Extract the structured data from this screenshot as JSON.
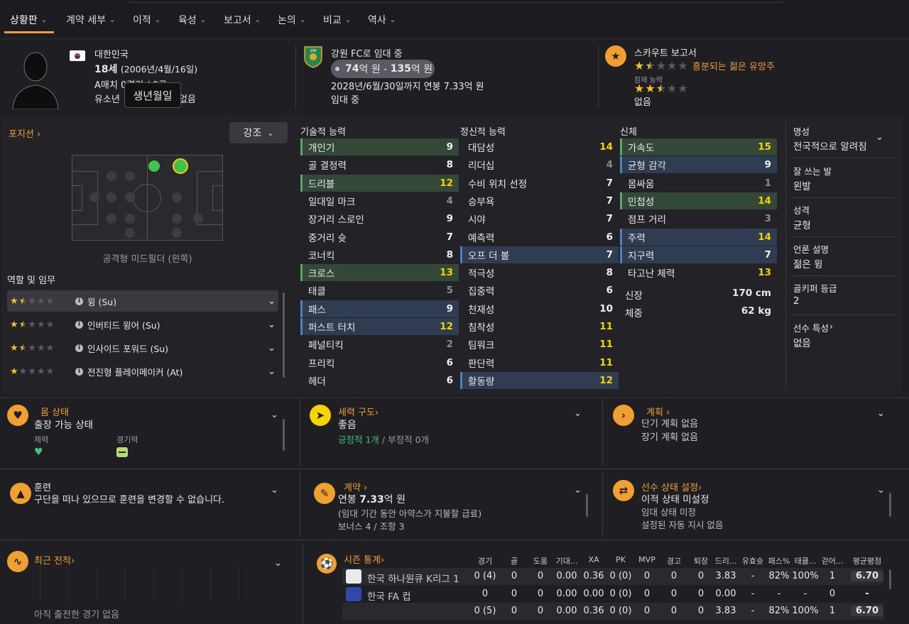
{
  "tabs": [
    {
      "label": "상황판"
    },
    {
      "label": "계약 세부"
    },
    {
      "label": "이적"
    },
    {
      "label": "육성"
    },
    {
      "label": "보고서"
    },
    {
      "label": "논의"
    },
    {
      "label": "비교"
    },
    {
      "label": "역사"
    }
  ],
  "header": {
    "nationality": "대한민국",
    "age": "18세",
    "dob": "(2006년/4월/16일)",
    "intl_line": "A매치 0경기 / 0골",
    "youth_line": "유소년",
    "youth_suffix": "없음",
    "tooltip": "생년월일",
    "loan_club": "강원 FC로 임대 중",
    "value_low": "74",
    "value_unit1": "억 원 - ",
    "value_high": "135",
    "value_unit2": "억 원",
    "contract_line": "2028년/6월/30일까지 연봉 7.33억 원",
    "loan_status": "임대 중",
    "scout_title": "스카우트 보고서",
    "scout_verdict": "흥분되는 젊은 유망주",
    "potential_label": "잠재 능력",
    "scout_none": "없음",
    "current_stars": 1.5,
    "potential_stars": 2.5
  },
  "position": {
    "label": "포지션",
    "highlight_button": "강조",
    "position_name": "공격형 미드필더 (왼쪽)"
  },
  "roles": {
    "label": "역할 및 임무",
    "items": [
      {
        "name": "윙 (Su)",
        "stars": 1.5
      },
      {
        "name": "인버티드 윙어 (Su)",
        "stars": 1.5
      },
      {
        "name": "인사이드 포워드 (Su)",
        "stars": 1.5
      },
      {
        "name": "전진형 플레이메이커 (At)",
        "stars": 1
      }
    ]
  },
  "technical": {
    "title": "기술적 능력",
    "rows": [
      {
        "name": "개인기",
        "value": "9",
        "hl": "green"
      },
      {
        "name": "골 결정력",
        "value": "8",
        "hl": ""
      },
      {
        "name": "드리블",
        "value": "12",
        "hl": "green"
      },
      {
        "name": "일대일 마크",
        "value": "4",
        "hl": ""
      },
      {
        "name": "장거리 스로인",
        "value": "9",
        "hl": ""
      },
      {
        "name": "중거리 슛",
        "value": "7",
        "hl": ""
      },
      {
        "name": "코너킥",
        "value": "8",
        "hl": ""
      },
      {
        "name": "크로스",
        "value": "13",
        "hl": "green"
      },
      {
        "name": "태클",
        "value": "5",
        "hl": ""
      },
      {
        "name": "패스",
        "value": "9",
        "hl": "blue"
      },
      {
        "name": "퍼스트 터치",
        "value": "12",
        "hl": "blue"
      },
      {
        "name": "페널티킥",
        "value": "2",
        "hl": ""
      },
      {
        "name": "프리킥",
        "value": "6",
        "hl": ""
      },
      {
        "name": "헤더",
        "value": "6",
        "hl": ""
      }
    ]
  },
  "mental": {
    "title": "정신적 능력",
    "rows": [
      {
        "name": "대담성",
        "value": "14",
        "hl": ""
      },
      {
        "name": "리더십",
        "value": "4",
        "hl": ""
      },
      {
        "name": "수비 위치 선정",
        "value": "7",
        "hl": ""
      },
      {
        "name": "승부욕",
        "value": "7",
        "hl": ""
      },
      {
        "name": "시야",
        "value": "7",
        "hl": ""
      },
      {
        "name": "예측력",
        "value": "6",
        "hl": ""
      },
      {
        "name": "오프 더 볼",
        "value": "7",
        "hl": "blue"
      },
      {
        "name": "적극성",
        "value": "8",
        "hl": ""
      },
      {
        "name": "집중력",
        "value": "6",
        "hl": ""
      },
      {
        "name": "천재성",
        "value": "10",
        "hl": ""
      },
      {
        "name": "침착성",
        "value": "11",
        "hl": ""
      },
      {
        "name": "팀워크",
        "value": "11",
        "hl": ""
      },
      {
        "name": "판단력",
        "value": "11",
        "hl": ""
      },
      {
        "name": "활동량",
        "value": "12",
        "hl": "blue"
      }
    ]
  },
  "physical": {
    "title": "신체",
    "rows": [
      {
        "name": "가속도",
        "value": "15",
        "hl": "green"
      },
      {
        "name": "균형 감각",
        "value": "9",
        "hl": "blue"
      },
      {
        "name": "몸싸움",
        "value": "1",
        "hl": ""
      },
      {
        "name": "민첩성",
        "value": "14",
        "hl": "green"
      },
      {
        "name": "점프 거리",
        "value": "3",
        "hl": ""
      },
      {
        "name": "주력",
        "value": "14",
        "hl": "blue"
      },
      {
        "name": "지구력",
        "value": "7",
        "hl": "blue"
      },
      {
        "name": "타고난 체력",
        "value": "13",
        "hl": ""
      }
    ],
    "height_label": "신장",
    "height": "170 cm",
    "weight_label": "체중",
    "weight": "62 kg"
  },
  "side_info": {
    "items": [
      {
        "label": "명성",
        "value": "전국적으로 알려짐"
      },
      {
        "label": "잘 쓰는 발",
        "value": "왼발"
      },
      {
        "label": "성격",
        "value": "균형"
      },
      {
        "label": "언론 설명",
        "value": "젊은 윙"
      },
      {
        "label": "골키퍼 등급",
        "value": "2"
      },
      {
        "label": "선수 특성",
        "value": "없음"
      }
    ]
  },
  "cards": {
    "condition": {
      "title": "몸 상태",
      "status": "출장 가능 상태",
      "stamina": "체력",
      "sharpness": "경기력"
    },
    "dynamics": {
      "title": "세력 구도",
      "status": "좋음",
      "positive": "긍정적 1개",
      "sep": "/",
      "negative": "부정적 0개"
    },
    "plans": {
      "title": "계획",
      "line1": "단기 계획 없음",
      "line2": "장기 계획 없음"
    },
    "training": {
      "title": "훈련",
      "text": "구단을 떠나 있으므로 훈련을 변경할 수 없습니다."
    },
    "contract": {
      "title": "계약",
      "salary_prefix": "연봉 ",
      "salary": "7.33",
      "salary_suffix": "억 원",
      "note": "(임대 기간 동안 아약스가 지불할 급료)",
      "bonus": "보너스 4 / 조항 3"
    },
    "status": {
      "title": "선수 상태 설정",
      "line1": "이적 상태 미설정",
      "line2": "임대 상태 미정",
      "line3": "설정된 자동 지시 없음"
    }
  },
  "form": {
    "title": "최근 전적",
    "empty": "아직 출전한 경기 없음"
  },
  "season": {
    "title": "시즌 통계",
    "headers": [
      "경기",
      "골",
      "도움",
      "기대...",
      "XA",
      "PK",
      "MVP",
      "경고",
      "퇴장",
      "드리...",
      "유효슛",
      "패스%",
      "태클...",
      "걷어...",
      "평균평점"
    ],
    "rows": [
      {
        "comp": "한국 하나원큐 K리그 1",
        "cells": [
          "0 (4)",
          "0",
          "0",
          "0.00",
          "0.36",
          "0 (0)",
          "0",
          "0",
          "0",
          "3.83",
          "-",
          "82%",
          "100%",
          "1",
          "6.70"
        ]
      },
      {
        "comp": "한국 FA 컵",
        "cells": [
          "0",
          "0",
          "0",
          "0.00",
          "0.00",
          "0 (0)",
          "0",
          "0",
          "0",
          "0.00",
          "-",
          "-",
          "-",
          "0",
          "-"
        ]
      },
      {
        "comp": "",
        "cells": [
          "0 (5)",
          "0",
          "0",
          "0.00",
          "0.36",
          "0 (0)",
          "0",
          "0",
          "0",
          "3.83",
          "-",
          "82%",
          "100%",
          "1",
          "6.70"
        ]
      }
    ]
  },
  "colors": {
    "accent": "#f0a030",
    "star": "#f5c518",
    "hl_green": "#334836",
    "hl_blue": "#2f3c52",
    "value_yellow": "#f5d400"
  }
}
